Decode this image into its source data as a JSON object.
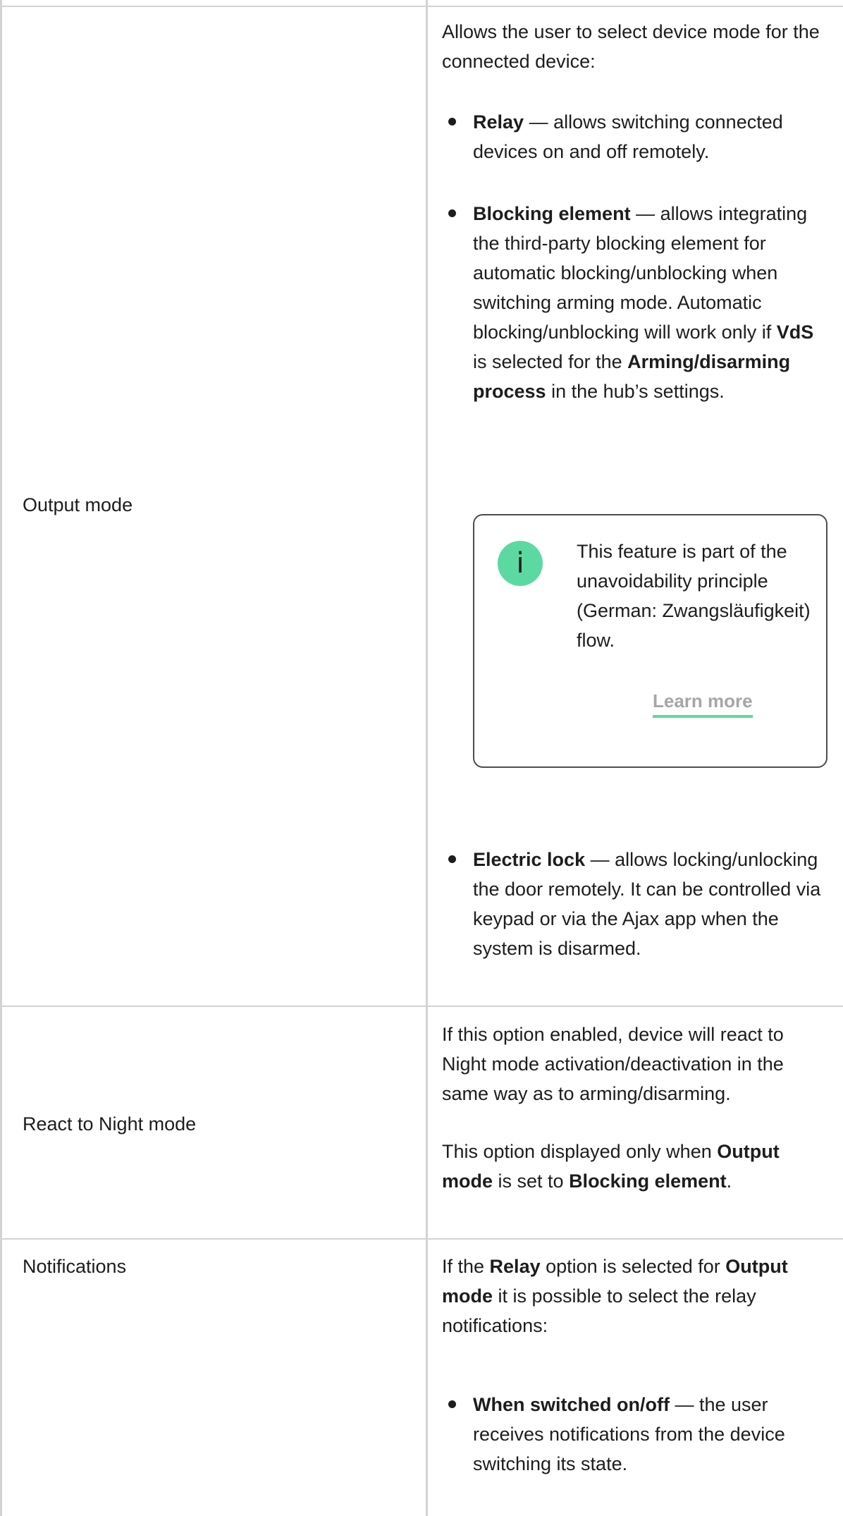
{
  "rows": [
    {
      "label": "Output mode",
      "intro": "Allows the user to select device mode for the connected device:",
      "bullets": [
        {
          "title": "Relay",
          "text": " — allows switching connected devices on and off remotely."
        },
        {
          "title": "Blocking element",
          "text_a": " — allows integrating the third-party blocking element for automatic blocking/unblocking when switching arming mode. Automatic blocking/unblocking will work only if ",
          "bold_a": "VdS",
          "text_b": " is selected for the ",
          "bold_b": "Arming/disarming process",
          "text_c": " in the hub’s settings."
        },
        {
          "title": "Electric lock",
          "text": " — allows locking/unlocking the door remotely. It can be controlled via keypad or via the Ajax app when the system is disarmed."
        }
      ],
      "note": {
        "icon": "info-icon",
        "icon_glyph": "i",
        "text": "This feature is part of the unavoidability principle (German: Zwangsläufigkeit) flow.",
        "link": "Learn more"
      }
    },
    {
      "label": "React to Night mode",
      "para1": "If this option enabled, device will react to Night mode activation/deactivation in the same way as to arming/disarming.",
      "para2_a": "This option displayed only when ",
      "para2_bold_a": "Output mode",
      "para2_b": " is set to ",
      "para2_bold_b": "Blocking element",
      "para2_c": "."
    },
    {
      "label": "Notifications",
      "intro_a": "If the ",
      "intro_bold_a": "Relay",
      "intro_b": " option is selected for ",
      "intro_bold_b": "Output mode",
      "intro_c": " it is possible to select the relay notifications:",
      "bullets": [
        {
          "title": "When switched on/off",
          "text": " — the user receives notifications from the device switching its state."
        }
      ]
    }
  ],
  "colors": {
    "accent": "#5bd9a0",
    "border": "#d3d3d3",
    "link_text": "#a6a6a6",
    "text": "#1d1d1d"
  }
}
